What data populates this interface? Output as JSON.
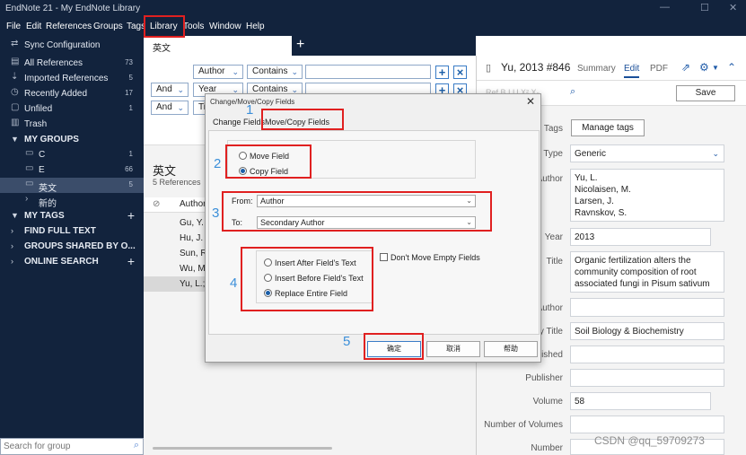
{
  "app": {
    "title": "EndNote 21 - My EndNote Library",
    "window_controls": [
      "—",
      "☐",
      "✕"
    ]
  },
  "menu": [
    "File",
    "Edit",
    "References",
    "Groups",
    "Tags",
    "Library",
    "Tools",
    "Window",
    "Help"
  ],
  "sidebar": {
    "sync": "Sync Configuration",
    "items": [
      {
        "label": "All References",
        "count": "73"
      },
      {
        "label": "Imported References",
        "count": "5"
      },
      {
        "label": "Recently Added",
        "count": "17"
      },
      {
        "label": "Unfiled",
        "count": "1"
      },
      {
        "label": "Trash",
        "count": ""
      }
    ],
    "my_groups": "MY GROUPS",
    "groups": [
      {
        "label": "C",
        "count": "1"
      },
      {
        "label": "E",
        "count": "66"
      },
      {
        "label": "英文",
        "count": "5"
      },
      {
        "label": "新的",
        "count": ""
      }
    ],
    "my_tags": "MY TAGS",
    "find_full_text": "FIND FULL TEXT",
    "groups_shared": "GROUPS SHARED BY O...",
    "online_search": "ONLINE SEARCH",
    "search_placeholder": "Search for group"
  },
  "tabs": {
    "active": "英文",
    "add": "+"
  },
  "search": {
    "rows": [
      {
        "bool": "",
        "field": "Author",
        "op": "Contains"
      },
      {
        "bool": "And",
        "field": "Year",
        "op": "Contains"
      },
      {
        "bool": "And",
        "field": "Ti",
        "op": ""
      }
    ],
    "plus": "+",
    "minus": "×"
  },
  "library": {
    "title": "英文",
    "count": "5 References",
    "col_author": "Author",
    "rows": [
      "Gu, Y.",
      "Hu, J. L",
      "Sun, R.",
      "Wu, M",
      "Yu, L.; l"
    ]
  },
  "reference": {
    "title": "Yu, 2013 #846",
    "tabs": [
      "Summary",
      "Edit",
      "PDF"
    ],
    "save": "Save",
    "toolbar_glyphs": "Ref   B  I  U  X²  X₂",
    "manage_tags": "Manage tags",
    "fields": {
      "tags": "Tags",
      "type_label": "Type",
      "type_value": "Generic",
      "author_label": "Author",
      "authors": [
        "Yu, L.",
        "Nicolaisen, M.",
        "Larsen, J.",
        "Ravnskov, S."
      ],
      "year_label": "Year",
      "year_value": "2013",
      "title_label": "Title",
      "title_value": "Organic fertilization alters the community composition of root associated fungi in Pisum sativum",
      "sec_author_label": "Author",
      "sec_title_label": "y Title",
      "sec_title_value": "Soil Biology & Biochemistry",
      "place_label": "olished",
      "publisher_label": "Publisher",
      "volume_label": "Volume",
      "volume_value": "58",
      "num_volumes_label": "Number of Volumes",
      "number_label": "Number"
    }
  },
  "dialog": {
    "title": "Change/Move/Copy Fields",
    "close": "✕",
    "tabs": [
      "Change Fields",
      "Move/Copy Fields"
    ],
    "move_field": "Move Field",
    "copy_field": "Copy Field",
    "from_label": "From:",
    "from_value": "Author",
    "to_label": "To:",
    "to_value": "Secondary Author",
    "insert_after": "Insert After Field's Text",
    "insert_before": "Insert Before Field's Text",
    "replace_entire": "Replace Entire Field",
    "dont_move_empty": "Don't Move Empty Fields",
    "ok": "确定",
    "cancel": "取消",
    "help": "帮助"
  },
  "annotations": [
    "1",
    "2",
    "3",
    "4",
    "5"
  ],
  "watermark": "CSDN @qq_59709273",
  "colors": {
    "sidebar_bg": "#12233d",
    "accent": "#1a4f99",
    "annotation_red": "#e02020",
    "annotation_num": "#3b8fd9"
  }
}
